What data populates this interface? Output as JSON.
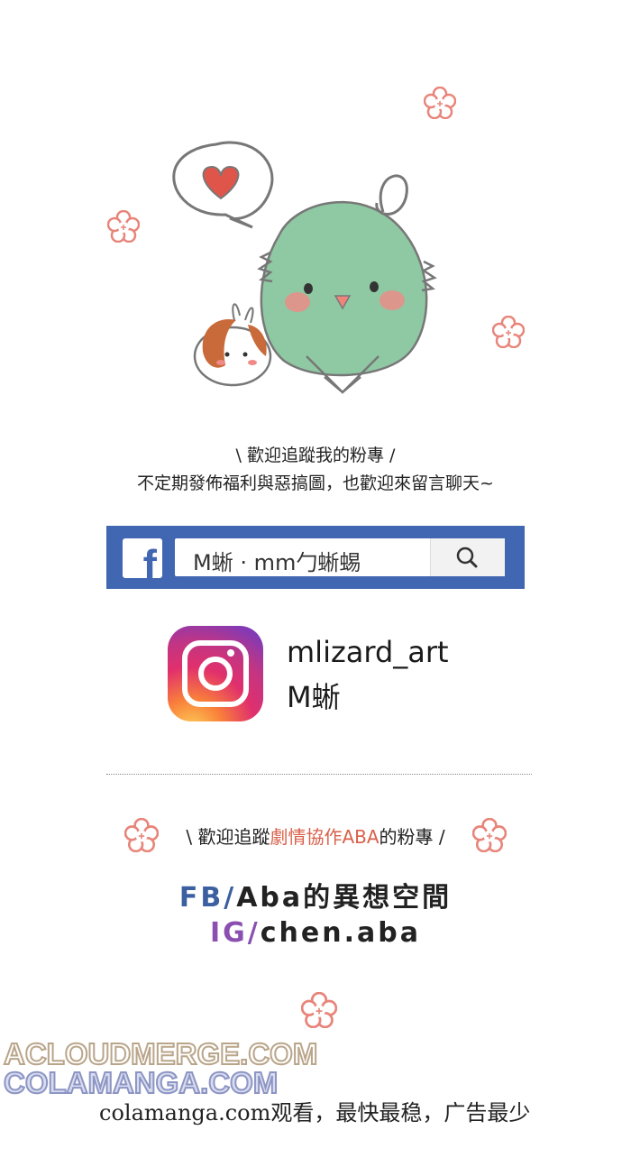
{
  "follow": {
    "line1": "\\ 歡迎追蹤我的粉專 /",
    "line2": "不定期發佈福利與惡搞圖，也歡迎來留言聊天~"
  },
  "facebook": {
    "logo": "f",
    "search_text": "M蜥 · mm勹蜥蜴",
    "search_icon": "search-icon"
  },
  "instagram": {
    "handle": "mlizard_art",
    "name": "M蜥"
  },
  "aba": {
    "prefix": "\\ 歡迎追蹤",
    "accent": "劇情協作ABA",
    "suffix": "的粉專 /",
    "fb_label": "FB/",
    "fb_value": "Aba的異想空間",
    "ig_label": "IG/",
    "ig_value": "chen.aba"
  },
  "watermark": {
    "line1": "ACLOUDMERGE.COM",
    "line2": "COLAMANGA.COM"
  },
  "footer": {
    "text": "colamanga.com观看，最快最稳，广告最少"
  },
  "colors": {
    "facebook_blue": "#4267b2",
    "accent_orange": "#d9604a",
    "fb_label_blue": "#3b5fa0",
    "ig_label_purple": "#8a4fb0",
    "flower_pink": "#e8857a"
  }
}
